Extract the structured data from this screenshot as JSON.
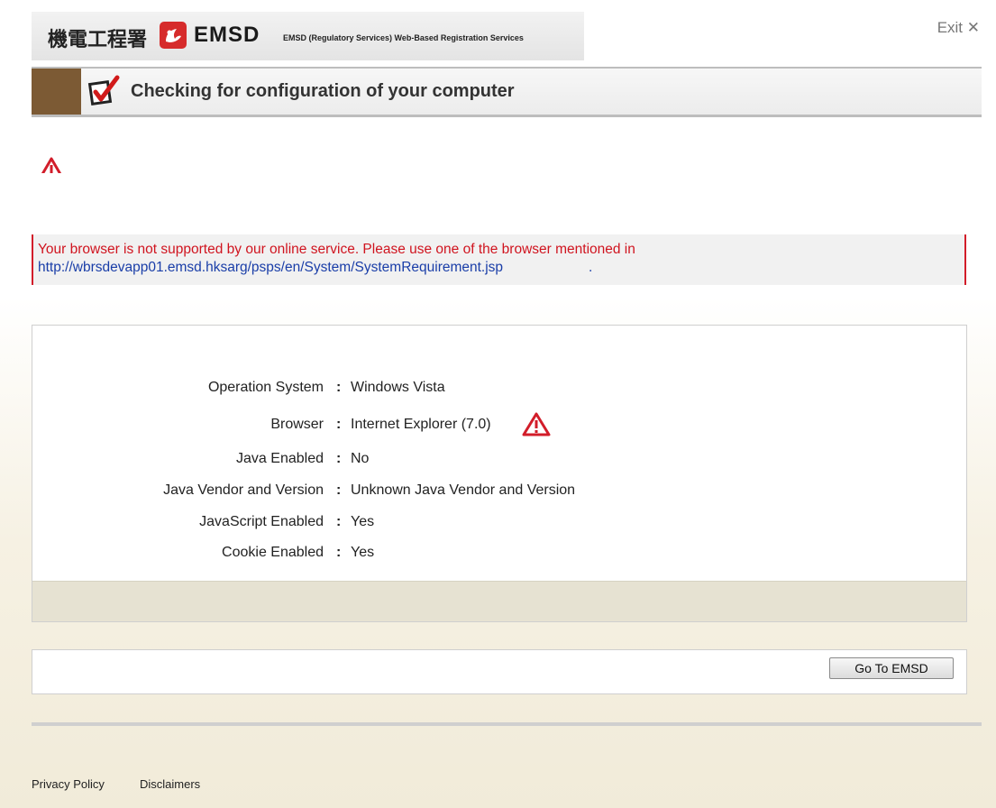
{
  "header": {
    "logo_chinese": "機電工程署",
    "logo_emsd": "EMSD",
    "subtitle": "EMSD (Regulatory Services) Web-Based Registration Services",
    "exit_label": "Exit ✕"
  },
  "title": "Checking for configuration of your computer",
  "error": {
    "message": "Your browser is not supported by our online service. Please use one of the browser mentioned in",
    "link": "http://wbrsdevapp01.emsd.hksarg/psps/en/System/SystemRequirement.jsp",
    "period": "."
  },
  "config": {
    "separator": ":",
    "rows": [
      {
        "label": "Operation System",
        "value": "Windows Vista"
      },
      {
        "label": "Browser",
        "value": "Internet Explorer (7.0)"
      },
      {
        "label": "Java Enabled",
        "value": "No"
      },
      {
        "label": "Java Vendor and Version",
        "value": "Unknown Java Vendor and Version"
      },
      {
        "label": "JavaScript Enabled",
        "value": "Yes"
      },
      {
        "label": "Cookie Enabled",
        "value": "Yes"
      }
    ]
  },
  "actions": {
    "go_emsd_label": "Go To EMSD"
  },
  "footer": {
    "privacy_label": "Privacy Policy",
    "disclaimers_label": "Disclaimers"
  },
  "colors": {
    "error_red": "#d0141f",
    "link_blue": "#1a3ea8",
    "title_accent": "#7c5a34",
    "panel_footer": "#e6e2d2"
  },
  "icons": [
    "emsd-logo-icon",
    "checkbox-tick-icon",
    "warning-triangle-icon"
  ]
}
